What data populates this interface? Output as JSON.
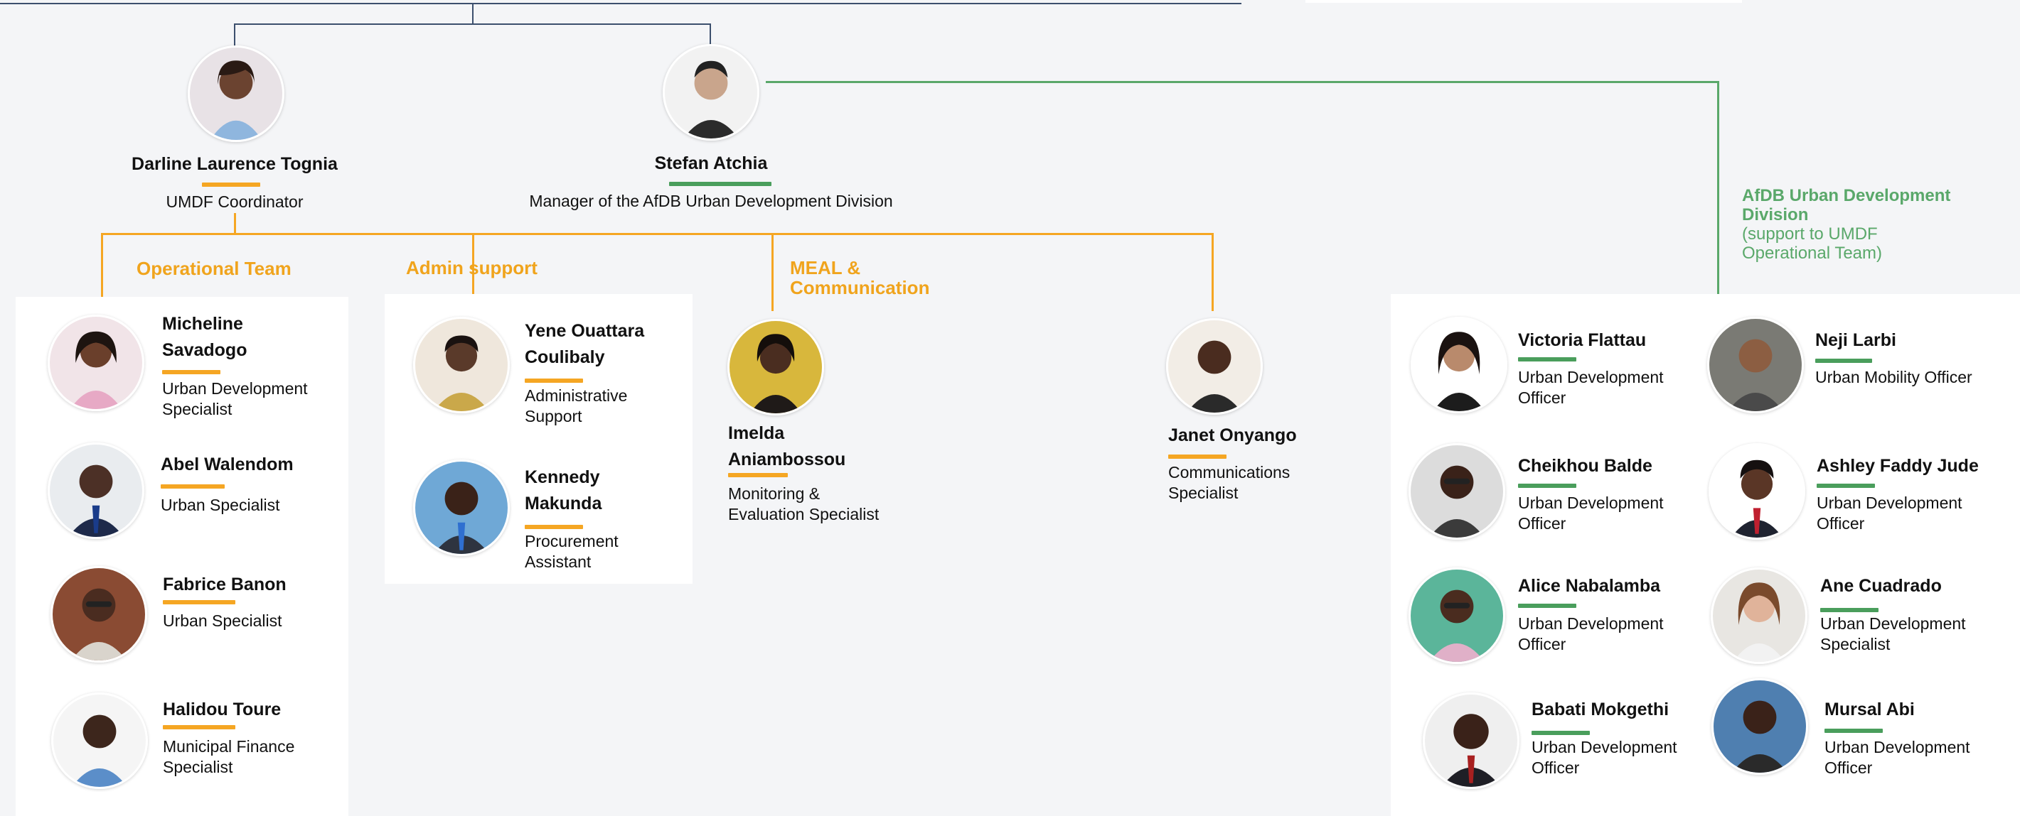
{
  "colors": {
    "accent_orange": "#f5a623",
    "accent_green": "#4a9e5c",
    "line_navy": "#3c4f6d",
    "background": "#f4f5f7"
  },
  "leaders": [
    {
      "name": "Darline Laurence Tognia",
      "role": "UMDF Coordinator"
    },
    {
      "name": "Stefan Atchia",
      "role": "Manager of the AfDB Urban Development Division"
    }
  ],
  "teams": {
    "operational": "Operational Team",
    "admin": "Admin support",
    "meal": "MEAL & Communication"
  },
  "afdb": {
    "title": "AfDB Urban Development Division",
    "subtitle": "(support to UMDF Operational Team)"
  },
  "operational_members": [
    {
      "name": "Micheline Savadogo",
      "role": "Urban Development Specialist"
    },
    {
      "name": "Abel Walendom",
      "role": "Urban Specialist"
    },
    {
      "name": "Fabrice Banon",
      "role": "Urban Specialist"
    },
    {
      "name": "Halidou Toure",
      "role": "Municipal Finance Specialist"
    }
  ],
  "admin_members": [
    {
      "name": "Yene Ouattara Coulibaly",
      "role": "Administrative Support"
    },
    {
      "name": "Kennedy Makunda",
      "role": "Procurement Assistant"
    }
  ],
  "meal_members": [
    {
      "name": "Imelda Aniambossou",
      "role": "Monitoring & Evaluation Specialist"
    },
    {
      "name": "Janet Onyango",
      "role": "Communications Specialist"
    }
  ],
  "afdb_members": [
    {
      "name": "Victoria Flattau",
      "role": "Urban Development Officer"
    },
    {
      "name": "Neji Larbi",
      "role": "Urban Mobility Officer"
    },
    {
      "name": "Cheikhou Balde",
      "role": "Urban Development Officer"
    },
    {
      "name": "Ashley Faddy Jude",
      "role": "Urban Development Officer"
    },
    {
      "name": "Alice Nabalamba",
      "role": "Urban Development Officer"
    },
    {
      "name": "Ane Cuadrado",
      "role": "Urban Development Specialist"
    },
    {
      "name": "Babati Mokgethi",
      "role": "Urban Development Officer"
    },
    {
      "name": "Mursal Abi",
      "role": "Urban Development Officer"
    }
  ]
}
